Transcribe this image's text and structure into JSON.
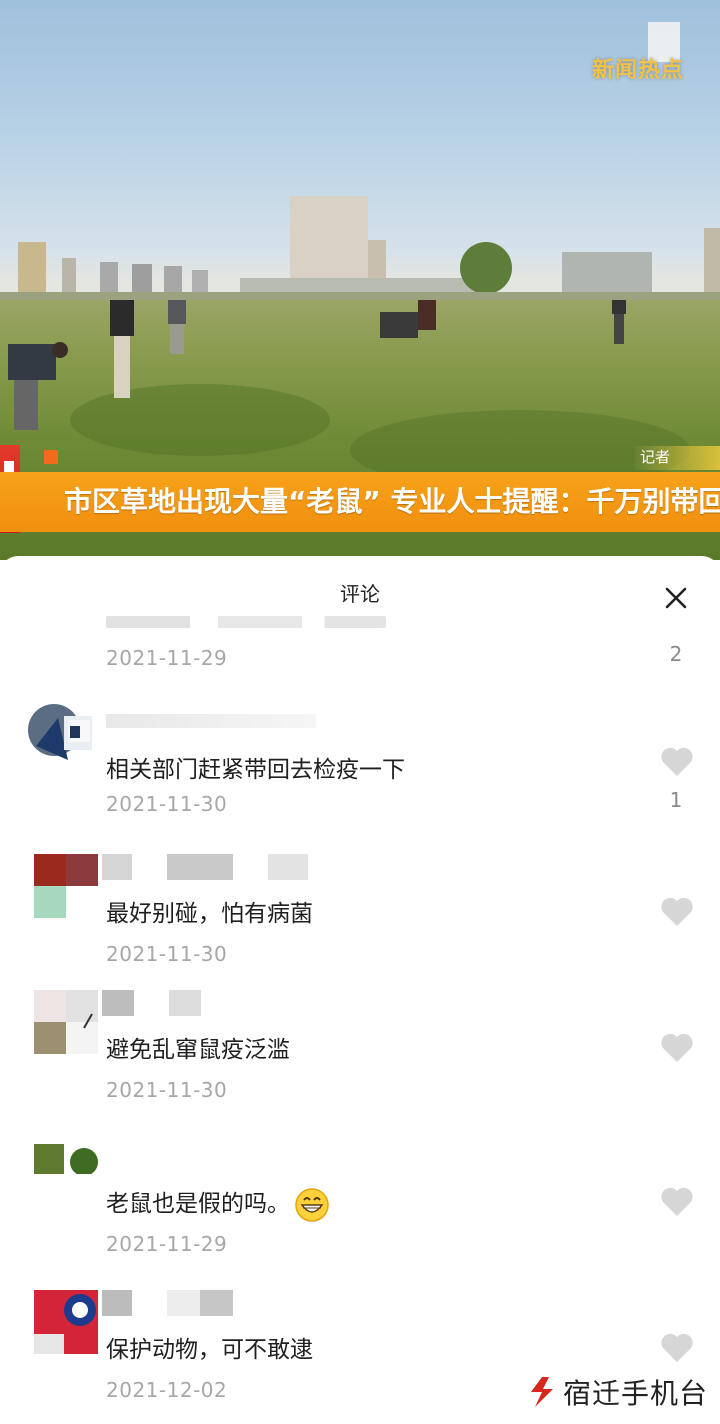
{
  "video": {
    "station_logo": "新闻热点",
    "reporter_tag": "记者",
    "headline": "市区草地出现大量“老鼠” 专业人士提醒：千万别带回"
  },
  "sheet": {
    "title": "评论"
  },
  "partial_comment": {
    "date": "2021-11-29",
    "likes": "2"
  },
  "comments": [
    {
      "text": "相关部门赶紧带回去检疫一下",
      "date": "2021-11-30",
      "likes": "1",
      "emoji": ""
    },
    {
      "text": "最好别碰，怕有病菌",
      "date": "2021-11-30",
      "likes": "",
      "emoji": ""
    },
    {
      "text": "避免乱窜鼠疫泛滥",
      "date": "2021-11-30",
      "likes": "",
      "emoji": ""
    },
    {
      "text": "老鼠也是假的吗。",
      "date": "2021-11-29",
      "likes": "",
      "emoji": "grinning-face"
    },
    {
      "text": "保护动物，可不敢逮",
      "date": "2021-12-02",
      "likes": "",
      "emoji": ""
    }
  ],
  "watermark": {
    "text": "宿迁手机台"
  },
  "colors": {
    "banner": "#f7a21a",
    "heart": "#d6d6d6",
    "date_text": "#a7a7a7"
  },
  "icons": {
    "close": "close-icon",
    "like": "heart-icon"
  }
}
